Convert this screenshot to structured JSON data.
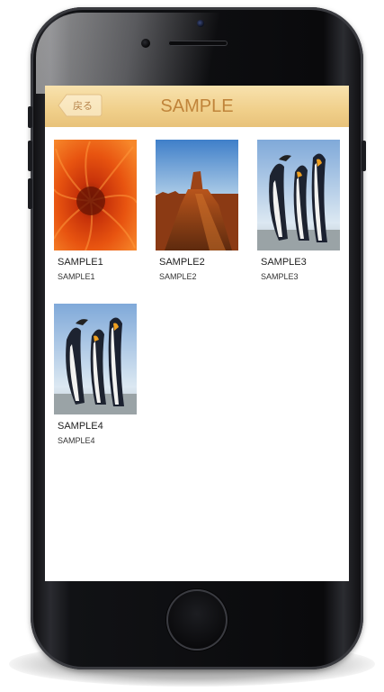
{
  "nav": {
    "back_label": "戻る",
    "title": "SAMPLE"
  },
  "items": [
    {
      "title": "SAMPLE1",
      "subtitle": "SAMPLE1",
      "image": "orange-flower"
    },
    {
      "title": "SAMPLE2",
      "subtitle": "SAMPLE2",
      "image": "desert-butte"
    },
    {
      "title": "SAMPLE3",
      "subtitle": "SAMPLE3",
      "image": "penguins"
    },
    {
      "title": "SAMPLE4",
      "subtitle": "SAMPLE4",
      "image": "penguins"
    }
  ],
  "colors": {
    "nav_bar": "#f0cf8a",
    "nav_title": "#c0843a",
    "phone_body": "#111215"
  }
}
